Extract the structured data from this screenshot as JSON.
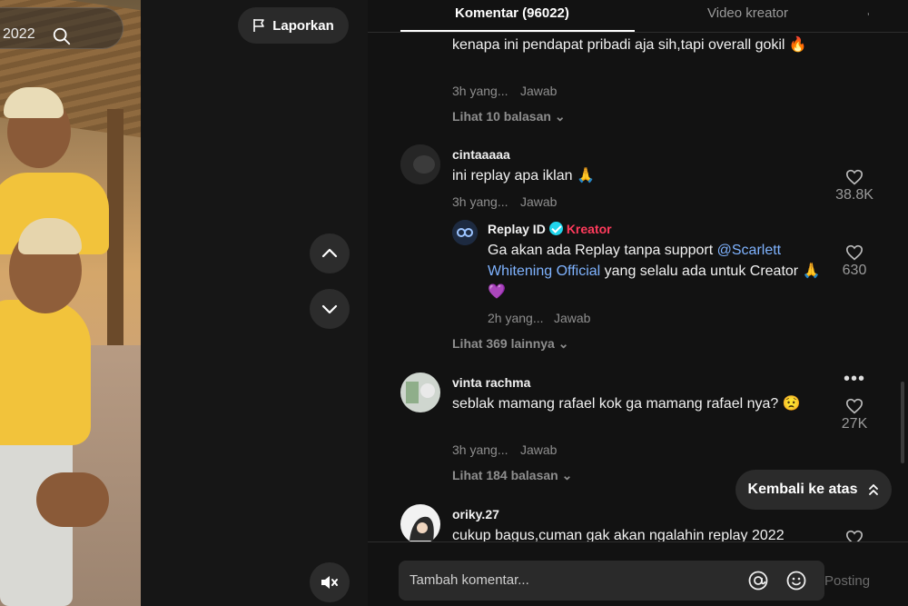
{
  "video": {
    "search_text": "2022",
    "report_label": "Laporkan"
  },
  "tabs": {
    "comments_label": "Komentar (96022)",
    "creator_videos_label": "Video kreator",
    "extra": "ʼ"
  },
  "comments": [
    {
      "text": "kenapa ini pendapat pribadi aja sih,tapi overall gokil 🔥",
      "time": "3h yang...",
      "reply_label": "Jawab",
      "view_replies": "Lihat 10 balasan"
    },
    {
      "username": "cintaaaaa",
      "text": "ini replay apa iklan 🙏",
      "time": "3h yang...",
      "reply_label": "Jawab",
      "likes": "38.8K",
      "reply": {
        "username": "Replay ID",
        "badge": "Kreator",
        "text_before": "Ga akan ada Replay tanpa support ",
        "mention": "@Scarlett Whitening Official",
        "text_after": " yang selalu ada untuk Creator 🙏 💜",
        "time": "2h yang...",
        "reply_label": "Jawab",
        "likes": "630"
      },
      "view_replies": "Lihat 369 lainnya"
    },
    {
      "username": "vinta rachma",
      "text": "seblak mamang rafael kok ga mamang rafael nya? 😟",
      "time": "3h yang...",
      "reply_label": "Jawab",
      "likes": "27K",
      "view_replies": "Lihat 184 balasan"
    },
    {
      "username": "oriky.27",
      "text": "cukup bagus,cuman gak akan ngalahin replay 2022"
    }
  ],
  "back_to_top_label": "Kembali ke atas",
  "input": {
    "placeholder": "Tambah komentar...",
    "post_label": "Posting"
  },
  "colors": {
    "background": "#121212",
    "accent_mention": "#7fb3ff",
    "creator_badge": "#ff3b5c"
  }
}
